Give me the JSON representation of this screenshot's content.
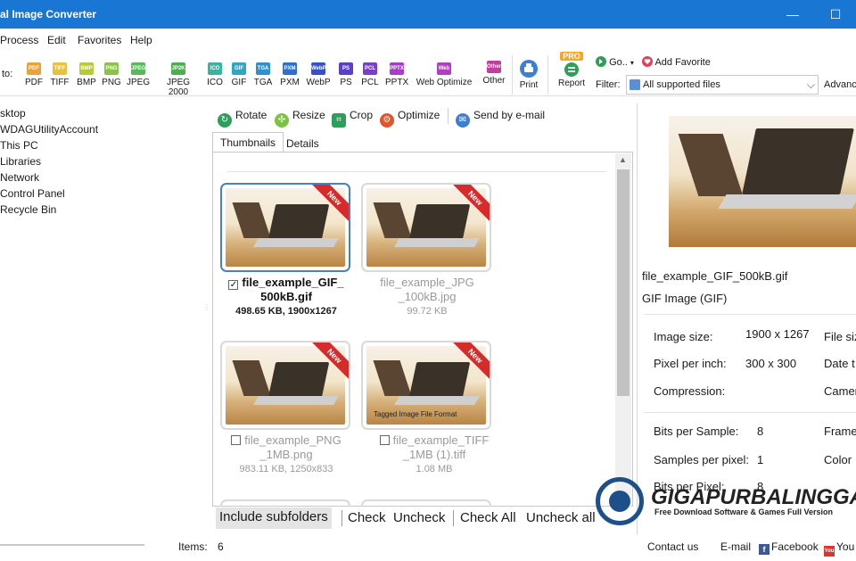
{
  "window": {
    "title": "al Image Converter",
    "minimize_glyph": "—",
    "maximize_glyph": "☐"
  },
  "menu": [
    "Process",
    "Edit",
    "Favorites",
    "Help"
  ],
  "toolbar": {
    "convert_to_label": "to:",
    "formats": [
      {
        "label": "PDF",
        "badge": "PDF",
        "color": "#e8a33c"
      },
      {
        "label": "TIFF",
        "badge": "TIFF",
        "color": "#e8c23c"
      },
      {
        "label": "BMP",
        "badge": "BMP",
        "color": "#b8c93a"
      },
      {
        "label": "PNG",
        "badge": "PNG",
        "color": "#8bc34a"
      },
      {
        "label": "JPEG",
        "badge": "JPEG",
        "color": "#5cb85c"
      },
      {
        "label": "JPEG 2000",
        "badge": "JP2K",
        "color": "#4caf50"
      },
      {
        "label": "ICO",
        "badge": "ICO",
        "color": "#3bb3a0"
      },
      {
        "label": "GIF",
        "badge": "GIF",
        "color": "#31a6c2"
      },
      {
        "label": "TGA",
        "badge": "TGA",
        "color": "#2f8fd0"
      },
      {
        "label": "PXM",
        "badge": "PXM",
        "color": "#2f6fd0"
      },
      {
        "label": "WebP",
        "badge": "WebP",
        "color": "#3552c9"
      },
      {
        "label": "PS",
        "badge": "PS",
        "color": "#5b3fc9"
      },
      {
        "label": "PCL",
        "badge": "PCL",
        "color": "#7a3fc9"
      },
      {
        "label": "PPTX",
        "badge": "PPTX",
        "color": "#a53fc9"
      },
      {
        "label": "Web Optimize",
        "badge": "Web",
        "color": "#b13fc0"
      },
      {
        "label": "Other",
        "badge": "Other",
        "color": "#c03f9a"
      }
    ],
    "print_label": "Print",
    "report_label": "Report",
    "pro_badge": "PRO",
    "go_label": "Go..",
    "add_favorite_label": "Add Favorite",
    "filter_label": "Filter:",
    "filter_value": "All supported files",
    "advanced_label": "Advanc"
  },
  "tree": [
    "sktop",
    "WDAGUtilityAccount",
    "This PC",
    "Libraries",
    "Network",
    "Control Panel",
    "Recycle Bin"
  ],
  "actions": [
    "Rotate",
    "Resize",
    "Crop",
    "Optimize",
    "Send by e-mail"
  ],
  "tabs": [
    "Thumbnails",
    "Details"
  ],
  "thumbnails": [
    {
      "name1": "file_example_GIF_",
      "name2": "500kB.gif",
      "meta": "498.65 KB, 1900x1267",
      "checked": true,
      "ribbon": "New",
      "overlay": ""
    },
    {
      "name1": "file_example_JPG",
      "name2": "_100kB.jpg",
      "meta": "99.72 KB",
      "checked": false,
      "ribbon": "New",
      "overlay": ""
    },
    {
      "name1": "file_example_PNG",
      "name2": "_1MB.png",
      "meta": "983.11 KB, 1250x833",
      "checked": false,
      "ribbon": "New",
      "overlay": ""
    },
    {
      "name1": "file_example_TIFF",
      "name2": "_1MB (1).tiff",
      "meta": "1.08 MB",
      "checked": false,
      "ribbon": "New",
      "overlay": "Tagged Image File Format"
    }
  ],
  "bottom_options": {
    "include_subfolders": "Include subfolders",
    "check": "Check",
    "uncheck": "Uncheck",
    "check_all": "Check All",
    "uncheck_all": "Uncheck all"
  },
  "status": {
    "items_label": "Items:",
    "items_count": "6",
    "contact": "Contact us",
    "email": "E-mail",
    "facebook": "Facebook",
    "youtube": "You",
    "facebook_glyph": "f",
    "youtube_glyph": "You"
  },
  "preview": {
    "filename": "file_example_GIF_500kB.gif",
    "type": "GIF Image (GIF)",
    "props": {
      "image_size_label": "Image size:",
      "image_size_value": "1900 x 1267",
      "file_size_label": "File siz",
      "ppi_label": "Pixel per inch:",
      "ppi_value": "300 x 300",
      "date_label": "Date t",
      "compression_label": "Compression:",
      "camera_label": "Camer",
      "bits_label": "Bits per Sample:",
      "bits_value": "8",
      "frames_label": "Frame",
      "samples_label": "Samples per pixel:",
      "samples_value": "1",
      "color_label": "Color",
      "bpp_label": "Bits per Pixel:",
      "bpp_value": "8"
    }
  },
  "watermark": {
    "title": "GIGAPURBALINGGA",
    "subtitle": "Free Download Software & Games Full Version"
  }
}
